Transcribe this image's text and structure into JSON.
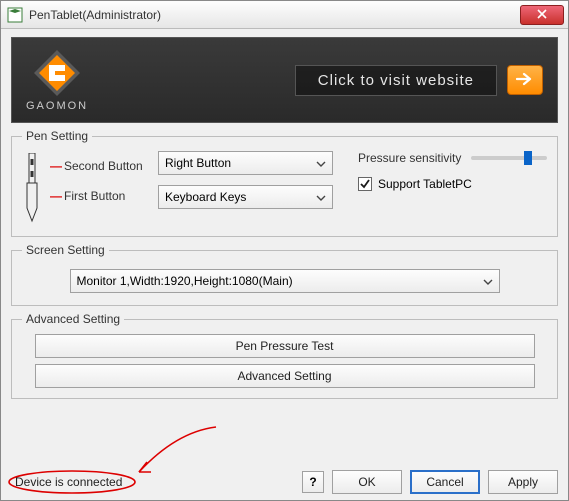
{
  "window": {
    "title": "PenTablet(Administrator)"
  },
  "banner": {
    "brand": "GAOMON",
    "visitLabel": "Click to visit website"
  },
  "penSetting": {
    "legend": "Pen Setting",
    "secondButtonLabel": "Second Button",
    "firstButtonLabel": "First Button",
    "secondButtonValue": "Right Button",
    "firstButtonValue": "Keyboard Keys",
    "pressureLabel": "Pressure sensitivity",
    "pressurePercent": 70,
    "supportTabletPCLabel": "Support TabletPC",
    "supportTabletPCChecked": true
  },
  "screenSetting": {
    "legend": "Screen Setting",
    "monitorValue": "Monitor 1,Width:1920,Height:1080(Main)"
  },
  "advancedSetting": {
    "legend": "Advanced Setting",
    "penPressureTest": "Pen Pressure Test",
    "advancedSetting": "Advanced Setting"
  },
  "footer": {
    "status": "Device is connected",
    "help": "?",
    "ok": "OK",
    "cancel": "Cancel",
    "apply": "Apply"
  }
}
